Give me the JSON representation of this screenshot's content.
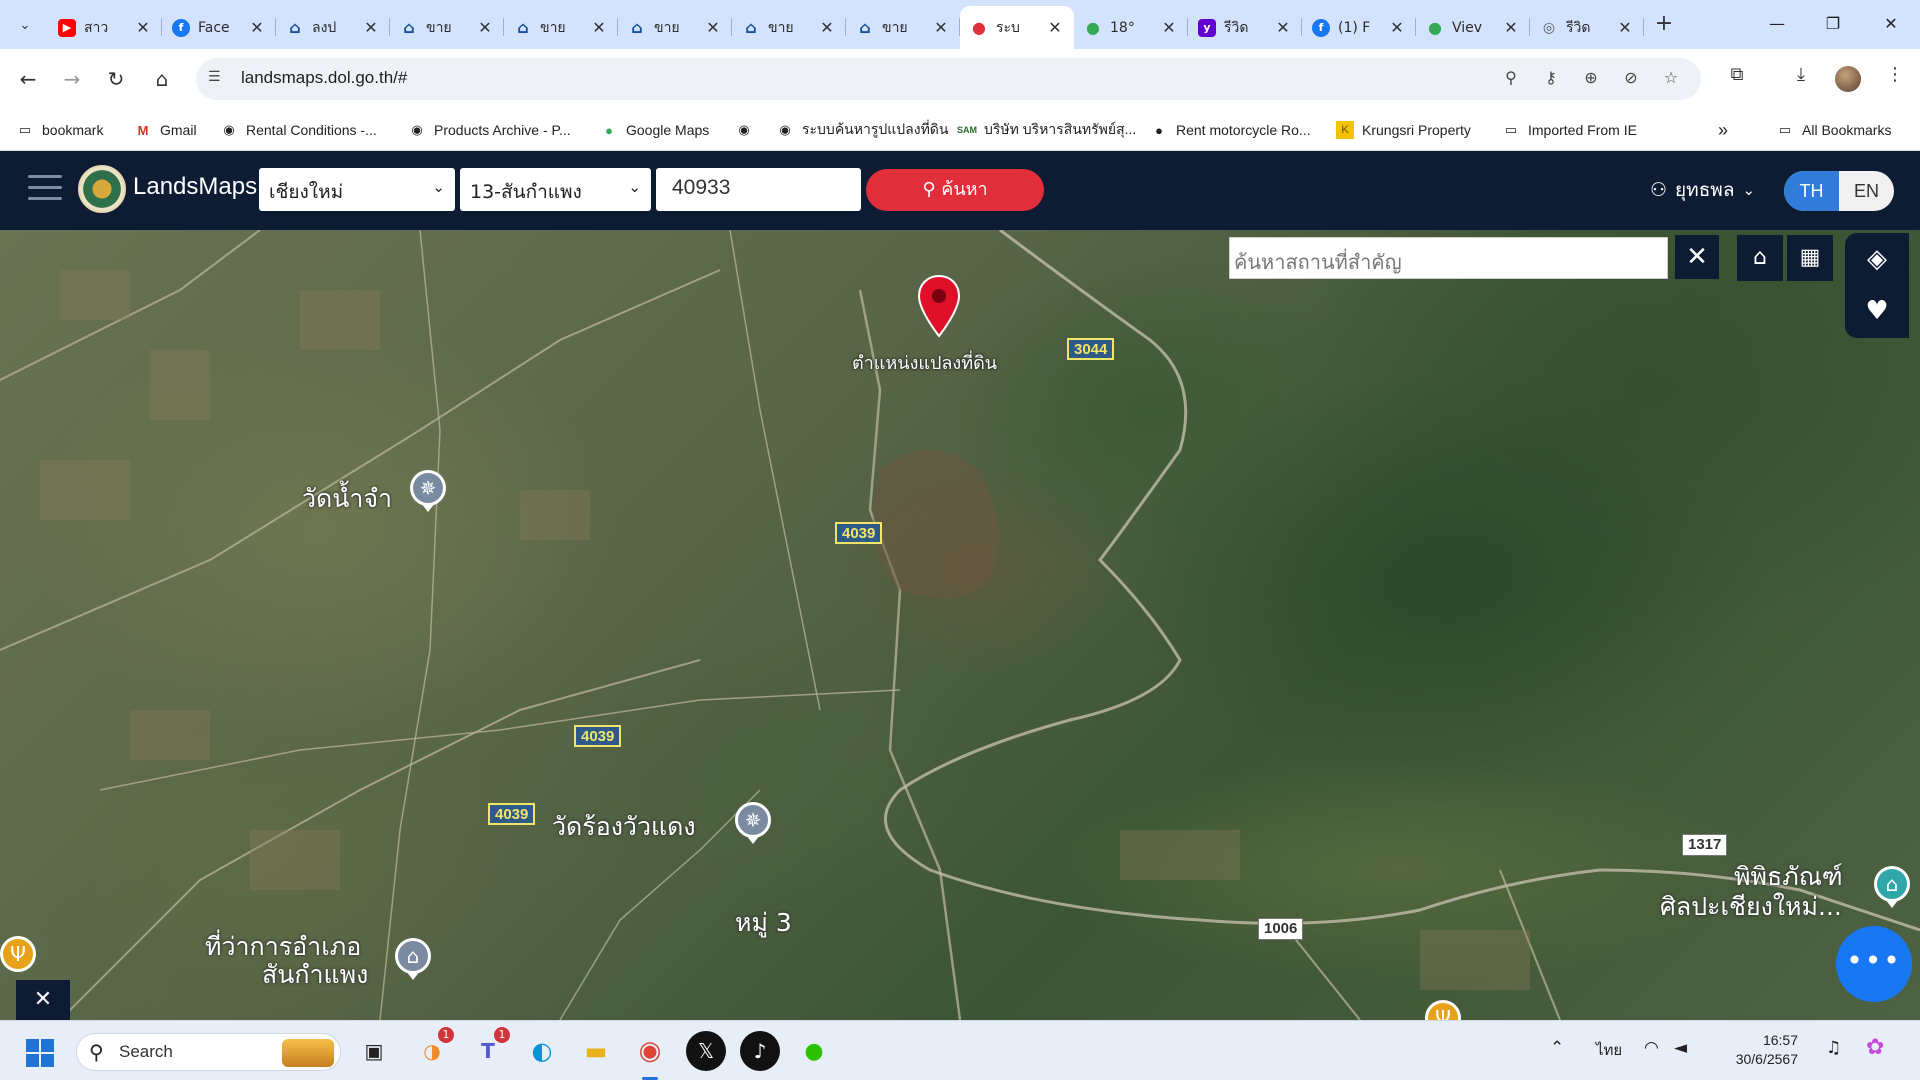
{
  "browser": {
    "tabs": [
      {
        "title": "สาว",
        "favicon": "youtube-icon",
        "color": "#ff0000",
        "active": false
      },
      {
        "title": "Face",
        "favicon": "facebook-icon",
        "color": "#1877f2",
        "active": false
      },
      {
        "title": "ลงป",
        "favicon": "house-icon",
        "color": "#1a4fa0",
        "active": false
      },
      {
        "title": "ขาย",
        "favicon": "house-icon",
        "color": "#1a4fa0",
        "active": false
      },
      {
        "title": "ขาย",
        "favicon": "house-icon",
        "color": "#1a4fa0",
        "active": false
      },
      {
        "title": "ขาย",
        "favicon": "house-icon",
        "color": "#1a4fa0",
        "active": false
      },
      {
        "title": "ขาย",
        "favicon": "house-icon",
        "color": "#1a4fa0",
        "active": false
      },
      {
        "title": "ขาย",
        "favicon": "house-icon",
        "color": "#1a4fa0",
        "active": false
      },
      {
        "title": "ระบ",
        "favicon": "map-pin-icon",
        "color": "#e02f3b",
        "active": true
      },
      {
        "title": "18°",
        "favicon": "google-maps-icon",
        "color": "#34a853",
        "active": false
      },
      {
        "title": "รีวิด",
        "favicon": "yahoo-icon",
        "color": "#6001d2",
        "active": false
      },
      {
        "title": "(1) F",
        "favicon": "facebook-icon",
        "color": "#1877f2",
        "active": false
      },
      {
        "title": "Viev",
        "favicon": "google-maps-icon",
        "color": "#34a853",
        "active": false
      },
      {
        "title": "รีวิด",
        "favicon": "search-favicon-icon",
        "color": "#555555",
        "active": false
      }
    ],
    "url": "landsmaps.dol.go.th/#",
    "bookmarks": [
      {
        "label": "bookmark",
        "icon": "folder-icon"
      },
      {
        "label": "Gmail",
        "icon": "gmail-icon"
      },
      {
        "label": "Rental Conditions -...",
        "icon": "globe-icon"
      },
      {
        "label": "Products Archive - P...",
        "icon": "globe-icon"
      },
      {
        "label": "Google Maps",
        "icon": "google-maps-icon"
      },
      {
        "label": "",
        "icon": "globe-icon"
      },
      {
        "label": "ระบบค้นหารูปแปลงที่ดิน",
        "icon": "globe-icon"
      },
      {
        "label": "บริษัท บริหารสินทรัพย์สุ...",
        "icon": "sam-icon"
      },
      {
        "label": "Rent motorcycle Ro...",
        "icon": "moto-icon"
      },
      {
        "label": "Krungsri Property",
        "icon": "krungsri-icon"
      },
      {
        "label": "Imported From IE",
        "icon": "folder-icon"
      }
    ],
    "all_bookmarks": "All Bookmarks"
  },
  "app": {
    "name": "LandsMaps",
    "province": "เชียงใหม่",
    "district": "13-สันกำแพง",
    "parcel_number": "40933",
    "search_label": "ค้นหา",
    "user_name": "ยุทธพล",
    "lang_th": "TH",
    "lang_en": "EN",
    "landmark_placeholder": "ค้นหาสถานที่สำคัญ"
  },
  "map": {
    "pin_label": "ตำแหน่งแปลงที่ดิน",
    "road_labels": [
      "3044",
      "4039",
      "4039",
      "4039",
      "1317",
      "1006"
    ],
    "places": [
      "วัดน้ำจำ",
      "วัดร้องวัวแดง",
      "หมู่ 3",
      "ที่ว่าการอำเภอ",
      "สันกำแพง",
      "พิพิธภัณฑ์",
      "ศิลปะเชียงใหม่..."
    ]
  },
  "taskbar": {
    "search_label": "Search",
    "lang": "ไทย",
    "time": "16:57",
    "date": "30/6/2567",
    "outlook_badge": "1",
    "teams_badge": "1"
  }
}
